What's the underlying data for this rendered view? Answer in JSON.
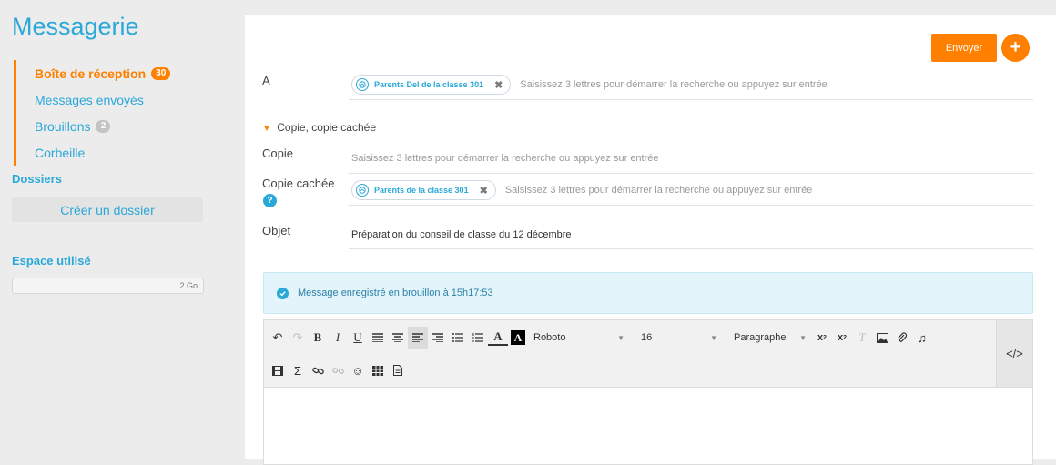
{
  "app": {
    "title": "Messagerie"
  },
  "colors": {
    "accent": "#2aa8d8",
    "brand": "#ff8000",
    "info_bg": "#e3f5fb"
  },
  "nav": [
    {
      "label": "Boîte de réception",
      "badge": "30",
      "active": true
    },
    {
      "label": "Messages envoyés",
      "badge": null,
      "active": false
    },
    {
      "label": "Brouillons",
      "badge": "2",
      "active": false
    },
    {
      "label": "Corbeille",
      "badge": null,
      "active": false
    }
  ],
  "folders": {
    "title": "Dossiers",
    "create_label": "Créer un dossier"
  },
  "storage": {
    "title": "Espace utilisé",
    "capacity": "2 Go",
    "used_fraction": 0
  },
  "compose": {
    "send_label": "Envoyer",
    "new_icon": "plus-icon",
    "to": {
      "label": "A",
      "chip": "Parents Del de la classe 301",
      "placeholder": "Saisissez 3 lettres pour démarrer la recherche ou appuyez sur entrée"
    },
    "cc_toggle": "Copie, copie cachée",
    "cc": {
      "label": "Copie",
      "placeholder": "Saisissez 3 lettres pour démarrer la recherche ou appuyez sur entrée"
    },
    "bcc": {
      "label": "Copie cachée",
      "chip": "Parents de la classe 301",
      "placeholder": "Saisissez 3 lettres pour démarrer la recherche ou appuyez sur entrée"
    },
    "subject": {
      "label": "Objet",
      "value": "Préparation du conseil de classe du 12 décembre"
    },
    "saved_notice": "Message enregistré en brouillon à 15h17:53"
  },
  "editor": {
    "font": "Roboto",
    "size": "16",
    "block": "Paragraphe",
    "code_label": "</>",
    "glyphs": {
      "bold": "B",
      "italic": "I",
      "underline": "U",
      "sigma": "Σ"
    },
    "icons_row1": [
      "undo-icon",
      "redo-icon",
      "bold-icon",
      "italic-icon",
      "underline-icon",
      "align-justify-icon",
      "align-center-icon",
      "align-left-icon",
      "align-right-icon",
      "bullet-list-icon",
      "numbered-list-icon",
      "text-color-icon",
      "background-color-icon",
      "subscript-icon",
      "superscript-icon",
      "clear-format-icon",
      "image-icon",
      "attachment-icon",
      "audio-icon"
    ],
    "icons_row2": [
      "video-icon",
      "formula-icon",
      "link-icon",
      "unlink-icon",
      "emoji-icon",
      "table-icon",
      "template-icon"
    ]
  }
}
